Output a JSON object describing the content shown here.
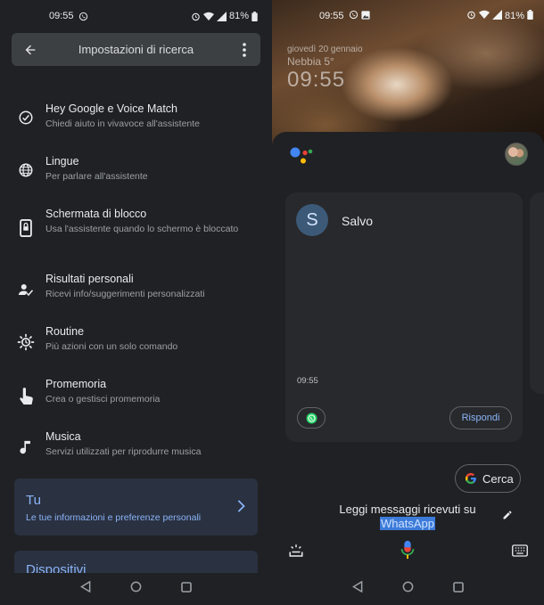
{
  "left": {
    "status": {
      "time": "09:55",
      "battery": "81%"
    },
    "header": {
      "title": "Impostazioni di ricerca"
    },
    "settings": [
      {
        "label": "Hey Google e Voice Match",
        "sub": "Chiedi aiuto in vivavoce all'assistente",
        "icon": "voice-match-icon"
      },
      {
        "label": "Lingue",
        "sub": "Per parlare all'assistente",
        "icon": "globe-icon"
      },
      {
        "label": "Schermata di blocco",
        "sub": "Usa l'assistente quando lo schermo è bloccato",
        "icon": "lock-screen-icon"
      },
      {
        "label": "Risultati personali",
        "sub": "Ricevi info/suggerimenti personalizzati",
        "icon": "personal-results-icon"
      },
      {
        "label": "Routine",
        "sub": "Più azioni con un solo comando",
        "icon": "routine-icon"
      },
      {
        "label": "Promemoria",
        "sub": "Crea o gestisci promemoria",
        "icon": "reminder-icon"
      },
      {
        "label": "Musica",
        "sub": "Servizi utilizzati per riprodurre musica",
        "icon": "music-icon"
      }
    ],
    "tu_card": {
      "title": "Tu",
      "sub": "Le tue informazioni e preferenze personali"
    },
    "dispositivi_card": {
      "title": "Dispositivi"
    }
  },
  "right": {
    "status": {
      "time": "09:55",
      "battery": "81%"
    },
    "lock": {
      "date": "giovedì 20 gennaio",
      "weather": "Nebbia 5°",
      "clock": "09:55"
    },
    "message": {
      "avatar_letter": "S",
      "sender": "Salvo",
      "time": "09:55",
      "reply_label": "Rispondi"
    },
    "cerca_label": "Cerca",
    "query": {
      "text": "Leggi messaggi ricevuti su",
      "highlight": "WhatsApp"
    }
  },
  "colors": {
    "background": "#202124",
    "accent": "#8ab4f8",
    "card": "#2a3140",
    "highlight": "#3d7bd9"
  }
}
